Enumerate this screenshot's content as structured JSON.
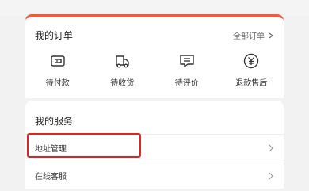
{
  "orders": {
    "title": "我的订单",
    "all_link": "全部订单",
    "items": [
      {
        "label": "待付款",
        "icon": "wallet-icon"
      },
      {
        "label": "待收货",
        "icon": "truck-icon"
      },
      {
        "label": "待评价",
        "icon": "comment-icon"
      },
      {
        "label": "退款售后",
        "icon": "yen-icon"
      }
    ]
  },
  "services": {
    "title": "我的服务",
    "rows": [
      {
        "label": "地址管理",
        "highlighted": true
      },
      {
        "label": "在线客服",
        "highlighted": false
      }
    ]
  },
  "colors": {
    "accent": "#ef5a42",
    "highlight": "#d9252a"
  }
}
